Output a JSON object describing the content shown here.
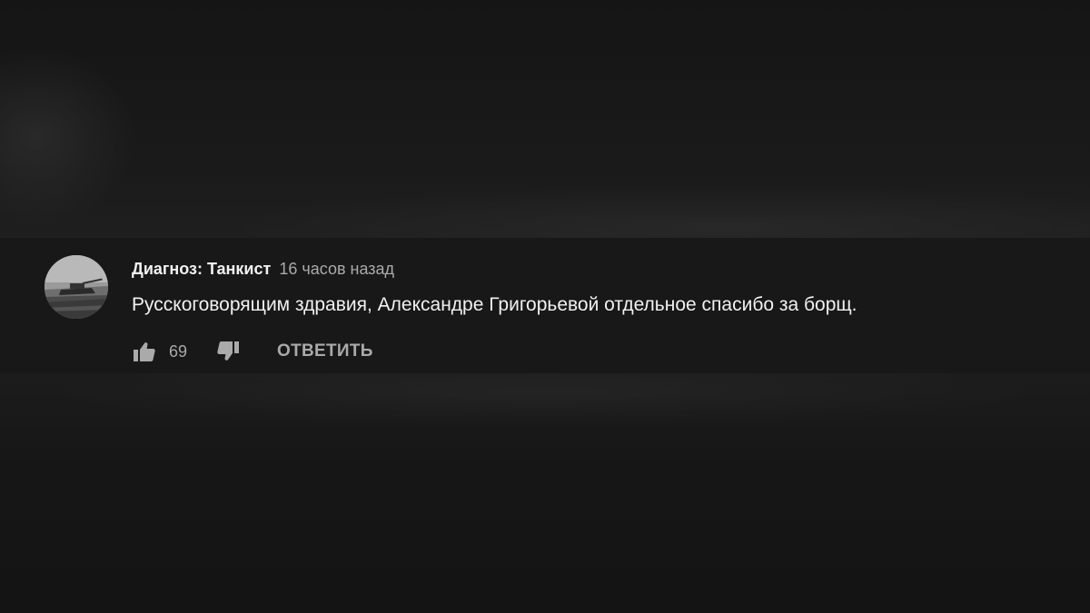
{
  "comment": {
    "author": "Диагноз: Танкист",
    "time": "16 часов назад",
    "text": "Русскоговорящим здравия, Александре Григорьевой отдельное спасибо за борщ.",
    "likes": "69",
    "reply_label": "ОТВЕТИТЬ",
    "avatar_icon": "tank-photo-avatar",
    "like_icon": "thumbs-up-icon",
    "dislike_icon": "thumbs-down-icon"
  },
  "colors": {
    "background": "#151515",
    "comment_band": "#181818",
    "primary_text": "#f1f1f1",
    "secondary_text": "#aaaaaa"
  }
}
